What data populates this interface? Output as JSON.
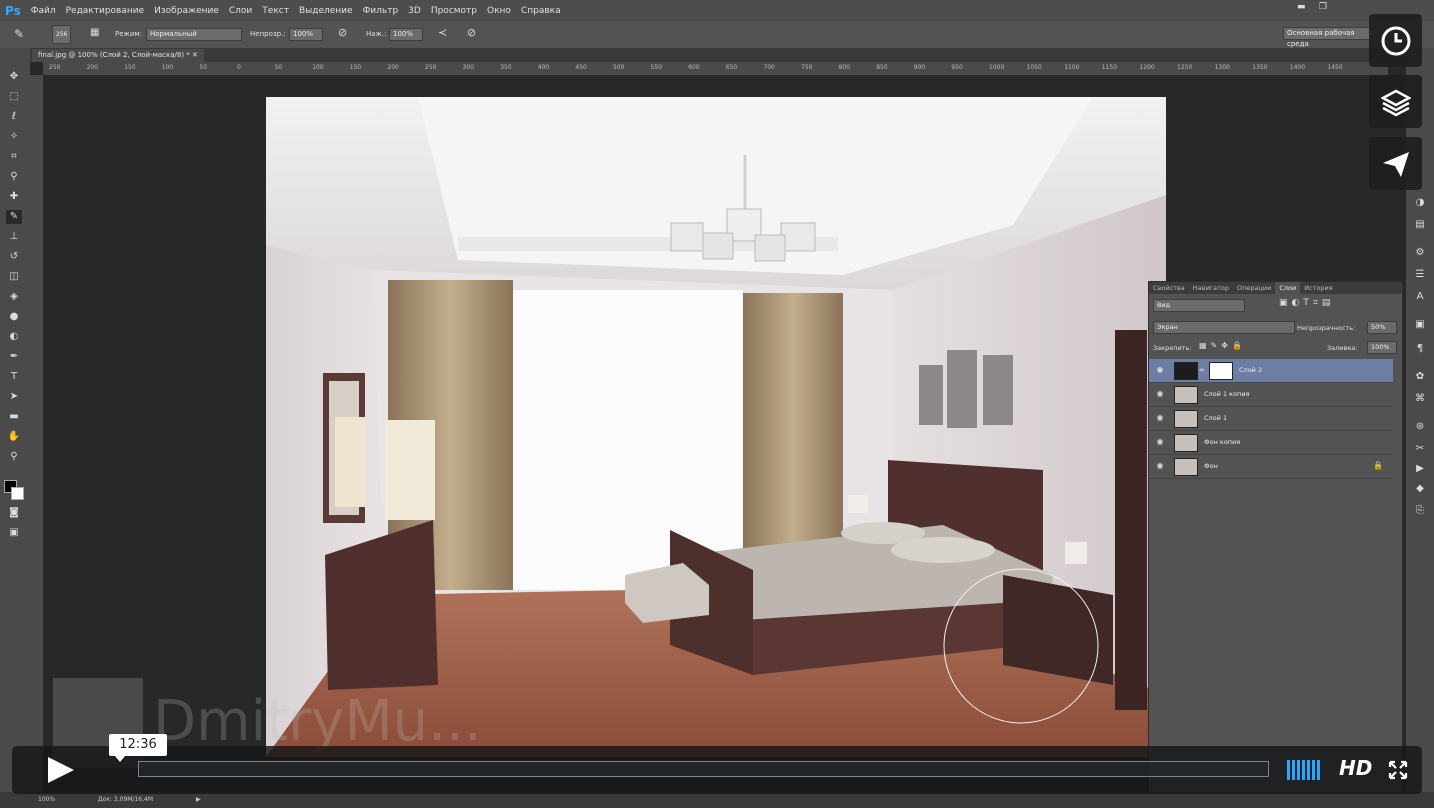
{
  "app": {
    "logo": "Ps",
    "menu": [
      "Файл",
      "Редактирование",
      "Изображение",
      "Слои",
      "Текст",
      "Выделение",
      "Фильтр",
      "3D",
      "Просмотр",
      "Окно",
      "Справка"
    ],
    "workspace": "Основная рабочая среда"
  },
  "options": {
    "brush_size": "256",
    "mode_label": "Режим:",
    "mode_value": "Нормальный",
    "opacity_label": "Непрозр.:",
    "opacity_value": "100%",
    "flow_label": "Наж.:",
    "flow_value": "100%"
  },
  "document": {
    "tab_title": "final.jpg @ 100% (Слой 2, Слой-маска/8) *"
  },
  "ruler": {
    "ticks": [
      "250",
      "200",
      "150",
      "100",
      "50",
      "0",
      "50",
      "100",
      "150",
      "200",
      "250",
      "300",
      "350",
      "400",
      "450",
      "500",
      "550",
      "600",
      "650",
      "700",
      "750",
      "800",
      "850",
      "900",
      "950",
      "1000",
      "1050",
      "1100",
      "1150",
      "1200",
      "1250",
      "1300",
      "1350",
      "1400",
      "1450"
    ]
  },
  "layers_panel": {
    "tabs": [
      "Свойства",
      "Навигатор",
      "Операции",
      "Слои",
      "История"
    ],
    "active_tab": "Слои",
    "filter_kind": "Вид",
    "blend_mode": "Экран",
    "opacity_label": "Непрозрачность:",
    "opacity_value": "50%",
    "lock_label": "Закрепить:",
    "fill_label": "Заливка:",
    "fill_value": "100%",
    "layers": [
      {
        "name": "Слой 2",
        "selected": true,
        "has_mask": true
      },
      {
        "name": "Слой 1 копия",
        "selected": false,
        "has_mask": false
      },
      {
        "name": "Слой 1",
        "selected": false,
        "has_mask": false
      },
      {
        "name": "Фон копия",
        "selected": false,
        "has_mask": false
      },
      {
        "name": "Фон",
        "selected": false,
        "has_mask": false,
        "locked": true
      }
    ]
  },
  "status": {
    "zoom": "100%",
    "doc_size": "Док: 3,09M/16,4M"
  },
  "player": {
    "time": "12:36",
    "progress": 0.0,
    "hd_label": "HD",
    "watermark": "DmitryMu..."
  },
  "colors": {
    "accent": "#2aa7ff",
    "selected_layer": "#6d7ea4",
    "ps_blue": "#31a8ff"
  }
}
